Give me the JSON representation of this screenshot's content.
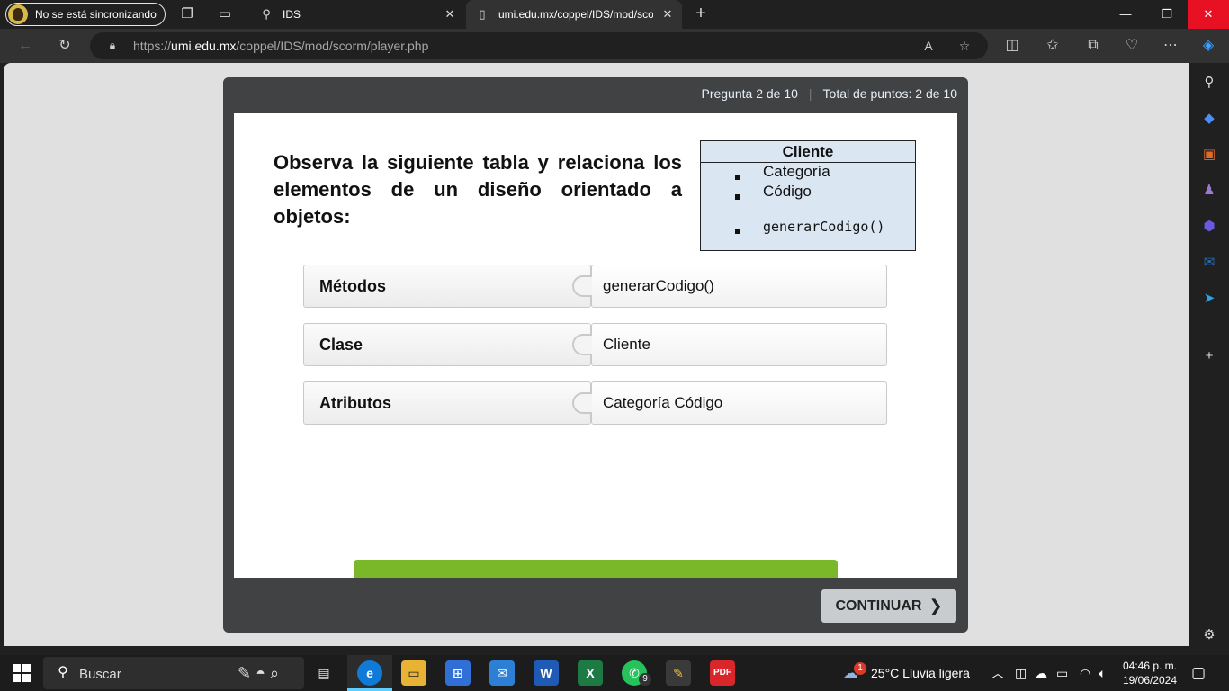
{
  "browser": {
    "profile_label": "No se está sincronizando",
    "tabs": [
      {
        "title": "IDS",
        "active": false
      },
      {
        "title": "umi.edu.mx/coppel/IDS/mod/scorm/player.php",
        "active": true
      }
    ],
    "url": {
      "scheme": "https://",
      "host": "umi.edu.mx",
      "path": "/coppel/IDS/mod/scorm/player.php"
    }
  },
  "quiz": {
    "progress": "Pregunta 2 de 10",
    "separator": "|",
    "points": "Total de puntos: 2 de 10",
    "question": "Observa la siguiente tabla y relaciona los elementos de un diseño orientado a objetos:",
    "uml_table": {
      "class_name": "Cliente",
      "items": [
        "Categoría",
        "Código",
        "generarCodigo()"
      ]
    },
    "matches": [
      {
        "label": "Métodos",
        "value": "generarCodigo()"
      },
      {
        "label": "Clase",
        "value": "Cliente"
      },
      {
        "label": "Atributos",
        "value": "Categoría Código"
      }
    ],
    "continue_label": "CONTINUAR"
  },
  "taskbar": {
    "search_label": "Buscar",
    "whatsapp_badge": "9",
    "weather_badge": "1",
    "weather": "25°C  Lluvia ligera",
    "time": "04:46 p. m.",
    "date": "19/06/2024"
  },
  "colors": {
    "accent_green": "#7ab82a",
    "close_red": "#e81123",
    "player_frame": "#404244"
  }
}
